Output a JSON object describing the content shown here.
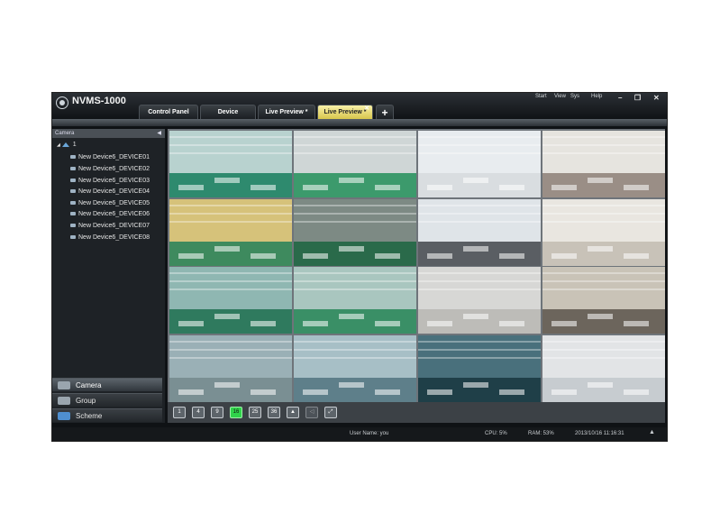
{
  "app": {
    "title": "NVMS-1000"
  },
  "menu": [
    "Start",
    "View",
    "Sys",
    "Help"
  ],
  "tabs": [
    {
      "label": "Control Panel"
    },
    {
      "label": "Device"
    },
    {
      "label": "Live Preview *"
    },
    {
      "label": "Live Preview *"
    }
  ],
  "sidebar": {
    "header": "Camera",
    "root": "1",
    "devices": [
      "New Device6_DEVICE01",
      "New Device6_DEVICE02",
      "New Device6_DEVICE03",
      "New Device6_DEVICE04",
      "New Device6_DEVICE05",
      "New Device6_DEVICE06",
      "New Device6_DEVICE07",
      "New Device6_DEVICE08"
    ],
    "nav": [
      "Camera",
      "Group",
      "Scheme"
    ]
  },
  "toolbar": {
    "buttons": [
      "1",
      "4",
      "9",
      "16",
      "25",
      "36"
    ]
  },
  "status": {
    "user": "User Name: you",
    "cpu": "CPU: 5%",
    "ram": "RAM: 53%",
    "datetime": "2013/10/16 11:16:31"
  },
  "colors": {
    "active_tab": "#d8c64c",
    "active_layout": "#2fd34a"
  }
}
